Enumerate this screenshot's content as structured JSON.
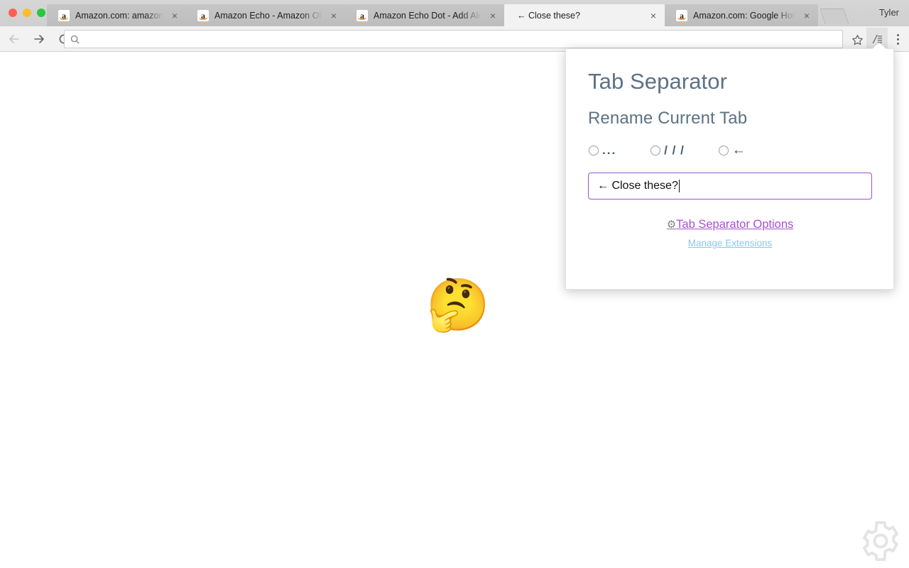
{
  "window": {
    "profile_name": "Tyler",
    "traffic_lights": [
      "close",
      "minimize",
      "zoom"
    ]
  },
  "tabs": [
    {
      "title": "Amazon.com: amazon echo",
      "favicon": "amazon-favicon",
      "active": false,
      "close_glyph": "×"
    },
    {
      "title": "Amazon Echo - Amazon Official Site",
      "favicon": "amazon-favicon",
      "active": false,
      "close_glyph": "×"
    },
    {
      "title": "Amazon Echo Dot - Add Alexa to any room",
      "favicon": "amazon-favicon",
      "active": false,
      "close_glyph": "×"
    },
    {
      "title": "← Close these?",
      "favicon": "none",
      "active": true,
      "close_glyph": "×"
    },
    {
      "title": "Amazon.com: Google Home: Certified",
      "favicon": "amazon-favicon",
      "active": false,
      "close_glyph": "×"
    }
  ],
  "toolbar": {
    "back_label": "Back",
    "forward_label": "Forward",
    "reload_label": "Reload",
    "url_value": "",
    "url_placeholder": "",
    "star_label": "Bookmark this page",
    "extension_label": "Tab Separator",
    "menu_label": "Customize and control Google Chrome"
  },
  "page": {
    "emoji": "🤔",
    "watermark": "gear-watermark"
  },
  "popup": {
    "title": "Tab Separator",
    "subtitle": "Rename Current Tab",
    "separators": [
      {
        "label": "...",
        "value": "dots",
        "selected": false
      },
      {
        "label": "/ / /",
        "value": "slashes",
        "selected": false
      },
      {
        "label": "←",
        "value": "arrow",
        "selected": false
      }
    ],
    "rename_input": {
      "value": "← Close these?",
      "placeholder": "Rename Current Tab",
      "focused": true
    },
    "options_link": {
      "icon": "⚙",
      "label": "Tab Separator Options"
    },
    "manage_link": "Manage Extensions"
  },
  "colors": {
    "heading": "#5d7185",
    "options_link": "#a64fd4",
    "manage_link": "#87c7f0",
    "input_border": "#9b51c9",
    "tabstrip_bg": "#d2d2d2",
    "toolbar_bg": "#f2f2f2"
  }
}
